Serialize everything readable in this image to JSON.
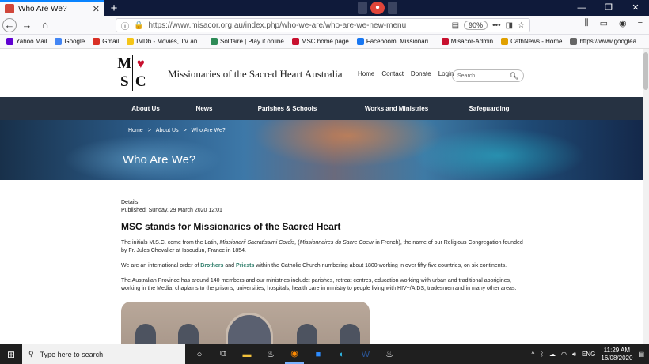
{
  "tab": {
    "title": "Who Are We?"
  },
  "nav": {
    "url": "https://www.misacor.org.au/index.php/who-we-are/who-are-we-new-menu",
    "zoom": "90%"
  },
  "bookmarks": [
    {
      "label": "Yahoo Mail",
      "color": "#6001d2"
    },
    {
      "label": "Google",
      "color": "#4285f4"
    },
    {
      "label": "Gmail",
      "color": "#d93025"
    },
    {
      "label": "IMDb - Movies, TV an...",
      "color": "#f5c518"
    },
    {
      "label": "Solitaire | Play it online",
      "color": "#2e8b57"
    },
    {
      "label": "MSC home page",
      "color": "#c8102e"
    },
    {
      "label": "Faceboom. Missionari...",
      "color": "#1877f2"
    },
    {
      "label": "Misacor-Admin",
      "color": "#c8102e"
    },
    {
      "label": "CathNews - Home",
      "color": "#e0a000"
    },
    {
      "label": "https://www.googlea...",
      "color": "#666666"
    }
  ],
  "site": {
    "logo": {
      "m": "M",
      "s": "S",
      "c": "C",
      "heart": "♥"
    },
    "name": "Missionaries of the Sacred Heart Australia",
    "toplinks": [
      "Home",
      "Contact",
      "Donate",
      "Login"
    ],
    "search_placeholder": "Search ...",
    "menu": [
      "About Us",
      "News",
      "Parishes & Schools",
      "Works and Ministries",
      "Safeguarding"
    ]
  },
  "hero": {
    "breadcrumb": {
      "home": "Home",
      "sep": ">",
      "about": "About Us",
      "current": "Who Are We?"
    },
    "title": "Who Are We?"
  },
  "article": {
    "details": "Details",
    "published": "Published: Sunday, 29 March 2020 12:01",
    "heading": "MSC stands for Missionaries of the Sacred Heart",
    "p1a": "The initials M.S.C. come from the Latin, ",
    "p1b": "Missionarii Sacratissimi Cordis,",
    "p1c": " (",
    "p1d": "Missionnaires du Sacre Coeur",
    "p1e": " in French), the name of our Religious Congregation founded by Fr. Jules Chevalier at Issoudun, France in 1854.",
    "p2a": "We are an international order of ",
    "p2b": "Brothers",
    "p2c": " and ",
    "p2d": "Priests",
    "p2e": " within the Catholic Church numbering about 1800 working in over fifty-five countries, on six continents.",
    "p3": "The Australian Province has around 140 members and our ministries include: parishes, retreat centres, education working with urban and traditional aborigines, working in the Media, chaplains to the prisons, universities, hospitals, health care in ministry to people living with HIV+/AIDS, tradesmen and in many other areas."
  },
  "taskbar": {
    "search_placeholder": "Type here to search",
    "time": "11:29 AM",
    "date": "16/08/2020",
    "lang": "ENG"
  }
}
